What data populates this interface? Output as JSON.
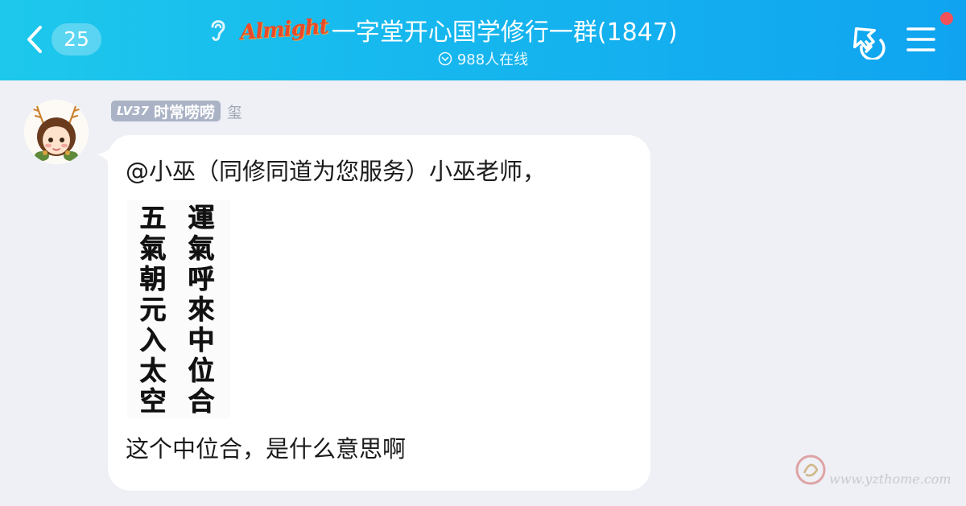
{
  "header": {
    "back_count": "25",
    "logo_text": "Almight",
    "group_title": "一字堂开心国学修行一群(1847)",
    "online_text": "988人在线",
    "colors": {
      "gradient_start": "#1dc8ec",
      "gradient_end": "#10a4f0",
      "notification_dot": "#f2515a"
    },
    "icons": [
      "back-chevron-icon",
      "ear-icon",
      "online-check-icon",
      "share-icon",
      "menu-icon"
    ]
  },
  "message": {
    "sender": {
      "level": "LV37",
      "nickname": "时常唠唠",
      "title": "玺"
    },
    "text_line1": "@小巫（同修同道为您服务）小巫老师，",
    "calligraphy": {
      "column_left": [
        "五",
        "氣",
        "朝",
        "元",
        "入",
        "太",
        "空"
      ],
      "column_right": [
        "運",
        "氣",
        "呼",
        "來",
        "中",
        "位",
        "合"
      ]
    },
    "text_line2": "这个中位合，是什么意思啊"
  },
  "watermark": {
    "text": "www.yzthome.com"
  }
}
